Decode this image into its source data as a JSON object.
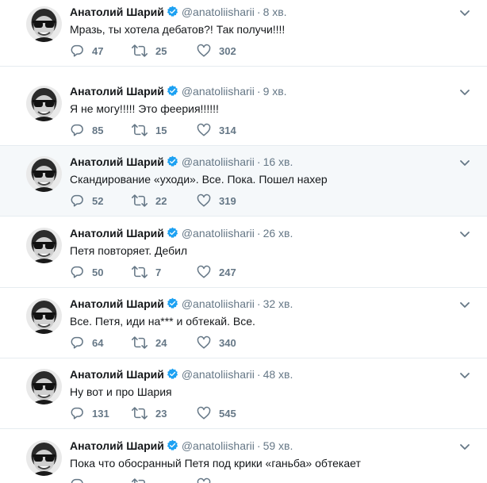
{
  "tweets": [
    {
      "name": "Анатолий Шарий",
      "handle": "@anatoliisharii",
      "separator": "·",
      "time": "8 хв.",
      "text": "Мразь, ты хотела дебатов?! Так получи!!!!",
      "replies": "47",
      "retweets": "25",
      "likes": "302"
    },
    {
      "name": "Анатолий Шарий",
      "handle": "@anatoliisharii",
      "separator": "·",
      "time": "9 хв.",
      "text": "Я не могу!!!!! Это феерия!!!!!!",
      "replies": "85",
      "retweets": "15",
      "likes": "314"
    },
    {
      "name": "Анатолий Шарий",
      "handle": "@anatoliisharii",
      "separator": "·",
      "time": "16 хв.",
      "text": "Скандирование «уходи». Все. Пока. Пошел нахер",
      "replies": "52",
      "retweets": "22",
      "likes": "319"
    },
    {
      "name": "Анатолий Шарий",
      "handle": "@anatoliisharii",
      "separator": "·",
      "time": "26 хв.",
      "text": "Петя повторяет. Дебил",
      "replies": "50",
      "retweets": "7",
      "likes": "247"
    },
    {
      "name": "Анатолий Шарий",
      "handle": "@anatoliisharii",
      "separator": "·",
      "time": "32 хв.",
      "text": "Все. Петя, иди на*** и обтекай. Все.",
      "replies": "64",
      "retweets": "24",
      "likes": "340"
    },
    {
      "name": "Анатолий Шарий",
      "handle": "@anatoliisharii",
      "separator": "·",
      "time": "48 хв.",
      "text": "Ну вот и про Шария",
      "replies": "131",
      "retweets": "23",
      "likes": "545"
    },
    {
      "name": "Анатолий Шарий",
      "handle": "@anatoliisharii",
      "separator": "·",
      "time": "59 хв.",
      "text": "Пока что обосранный Петя под крики «ганьба» обтекает",
      "replies": "",
      "retweets": "",
      "likes": ""
    }
  ],
  "colors": {
    "text": "#14171a",
    "muted": "#657786",
    "verified": "#1da1f2",
    "divider": "#e6ecf0",
    "highlight_row": "#f5f8fa"
  },
  "icons": {
    "reply": "reply-icon",
    "retweet": "retweet-icon",
    "like": "heart-icon",
    "verified": "verified-badge-icon",
    "menu": "chevron-down-icon"
  }
}
